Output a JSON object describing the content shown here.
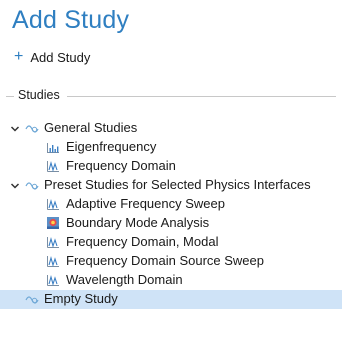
{
  "header": {
    "title": "Add Study",
    "add_study_label": "Add Study"
  },
  "studies_group": {
    "label": "Studies"
  },
  "tree": {
    "general": {
      "label": "General Studies",
      "children": [
        "Eigenfrequency",
        "Frequency Domain"
      ]
    },
    "preset": {
      "label": "Preset Studies for Selected Physics Interfaces",
      "children": [
        "Adaptive Frequency Sweep",
        "Boundary Mode Analysis",
        "Frequency Domain, Modal",
        "Frequency Domain Source Sweep",
        "Wavelength Domain"
      ]
    },
    "empty": {
      "label": "Empty Study",
      "selected": true
    }
  },
  "icons": {
    "folder_group": "study-group-icon",
    "eigenfrequency": "eigenfrequency-icon",
    "frequency_domain": "frequency-domain-icon",
    "boundary_mode": "boundary-mode-icon"
  },
  "colors": {
    "accent": "#2f7fc1",
    "selection": "#cfe3f7"
  }
}
